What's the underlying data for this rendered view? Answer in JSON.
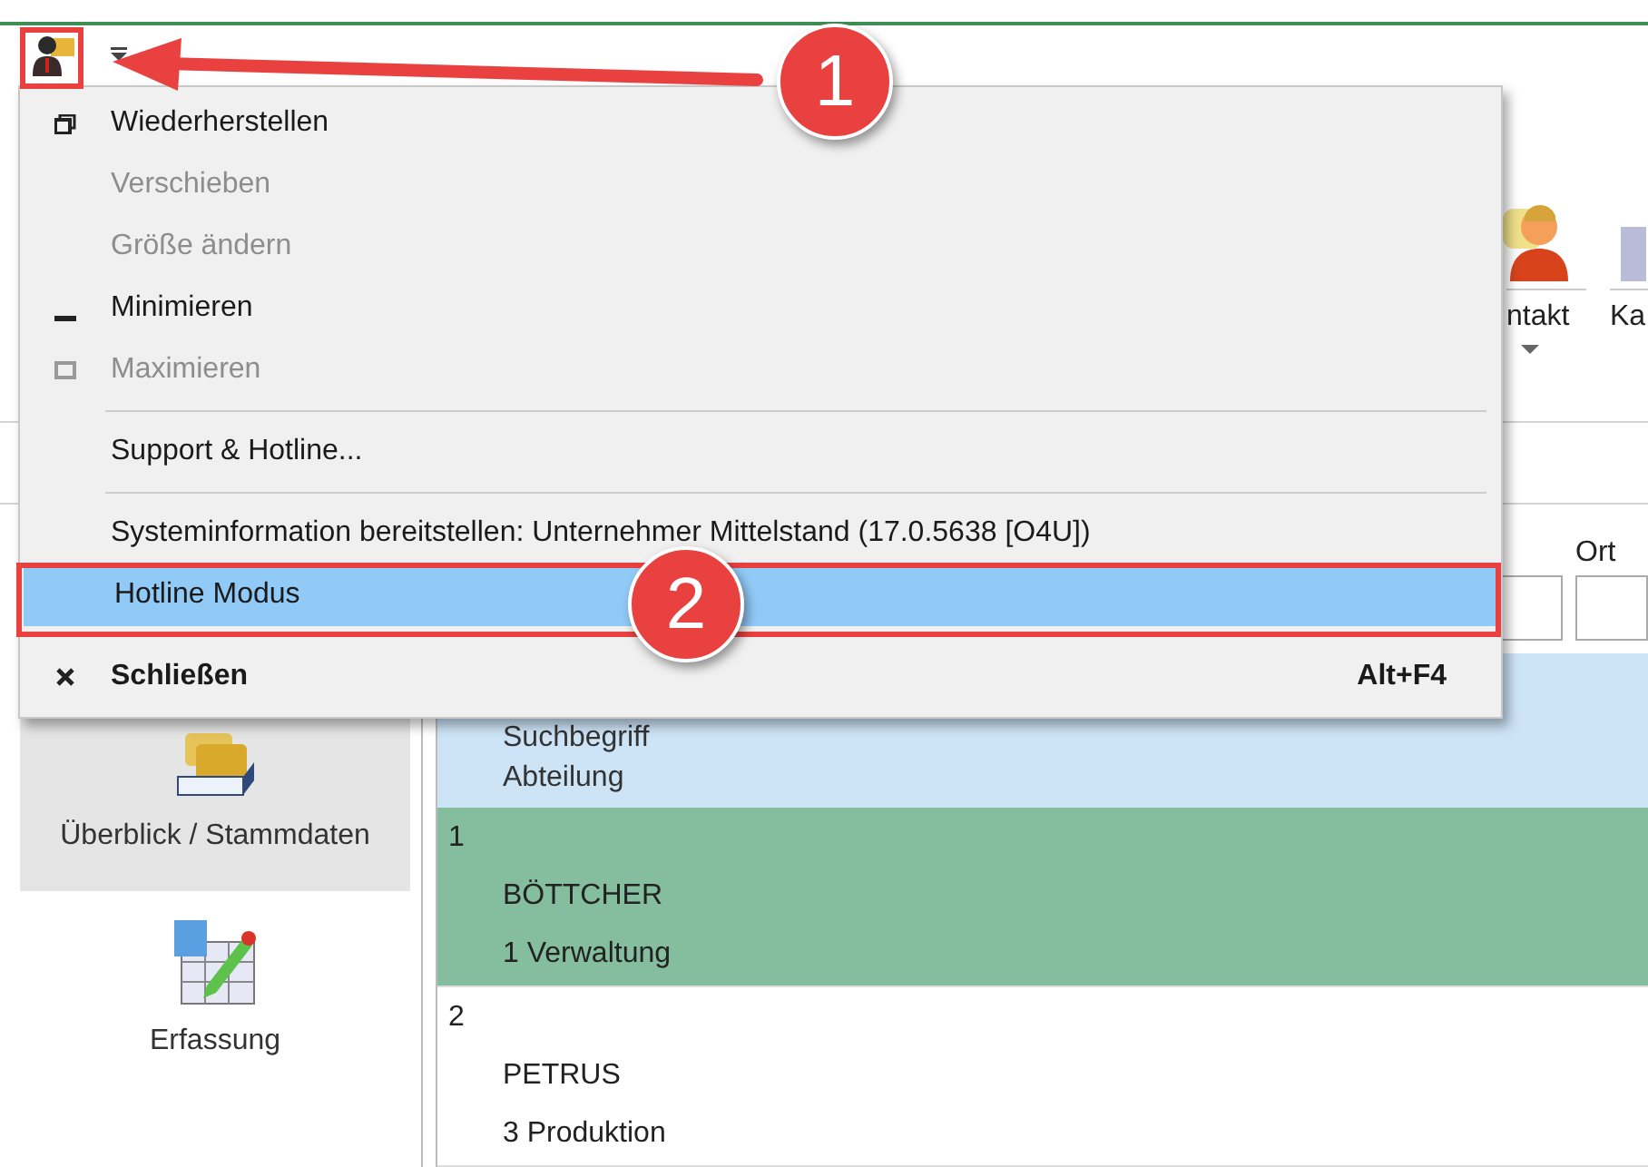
{
  "ribbon": {
    "buttons": [
      {
        "kind": "contact",
        "label": "ntakt",
        "dropdown": true
      },
      {
        "kind": "card",
        "label": "Ka",
        "dropdown": false
      }
    ]
  },
  "filter": {
    "label": "Ort"
  },
  "sidebar": {
    "items": [
      {
        "kind": "folders",
        "label": "Überblick / Stammdaten",
        "selected": true
      },
      {
        "kind": "sheet",
        "label": "Erfassung",
        "selected": false
      }
    ]
  },
  "list": {
    "header": [
      "Suchbegriff",
      "Abteilung"
    ],
    "rows": [
      {
        "number": "1",
        "name": "BÖTTCHER",
        "department": "1 Verwaltung",
        "selected": true
      },
      {
        "number": "2",
        "name": "PETRUS",
        "department": "3 Produktion",
        "selected": false
      }
    ]
  },
  "system_menu": {
    "items": [
      {
        "kind": "restore",
        "label": "Wiederherstellen",
        "disabled": false,
        "selected": false,
        "bold": false
      },
      {
        "kind": "plain",
        "label": "Verschieben",
        "disabled": true,
        "selected": false,
        "bold": false
      },
      {
        "kind": "plain",
        "label": "Größe ändern",
        "disabled": true,
        "selected": false,
        "bold": false
      },
      {
        "kind": "minimize",
        "label": "Minimieren",
        "disabled": false,
        "selected": false,
        "bold": false
      },
      {
        "kind": "maximize",
        "label": "Maximieren",
        "disabled": true,
        "selected": false,
        "bold": false
      },
      {
        "kind": "separator"
      },
      {
        "kind": "plain",
        "label": "Support & Hotline...",
        "disabled": false,
        "selected": false,
        "bold": false
      },
      {
        "kind": "separator"
      },
      {
        "kind": "plain",
        "label": "Systeminformation bereitstellen: Unternehmer Mittelstand (17.0.5638 [O4U])",
        "disabled": false,
        "selected": false,
        "bold": false
      },
      {
        "kind": "plain",
        "label": "Hotline Modus",
        "disabled": false,
        "selected": true,
        "bold": false
      },
      {
        "kind": "separator"
      },
      {
        "kind": "close",
        "label": "Schließen",
        "shortcut": "Alt+F4",
        "disabled": false,
        "selected": false,
        "bold": true
      }
    ]
  },
  "annotations": [
    {
      "kind": "arrow",
      "number": "1"
    },
    {
      "kind": "frame",
      "number": "2"
    }
  ]
}
